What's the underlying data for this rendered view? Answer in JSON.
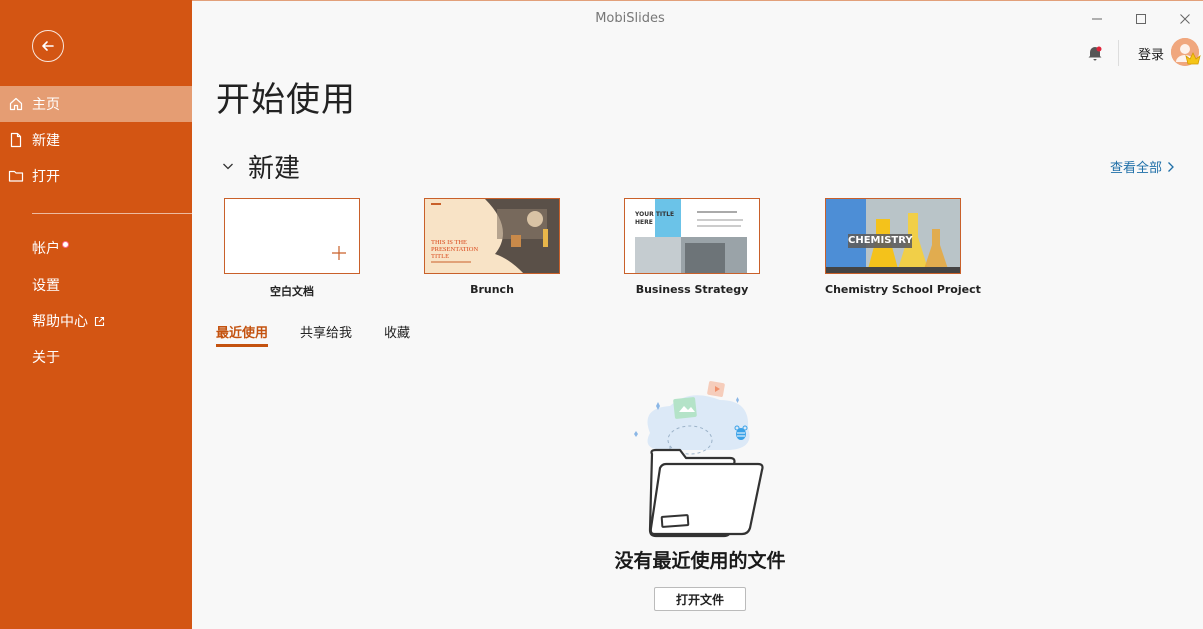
{
  "app": {
    "title": "MobiSlides"
  },
  "sidebar": {
    "nav": [
      {
        "label": "主页",
        "icon": "home-icon",
        "active": true
      },
      {
        "label": "新建",
        "icon": "new-file-icon"
      },
      {
        "label": "打开",
        "icon": "folder-icon"
      }
    ],
    "links": [
      {
        "label": "帐户"
      },
      {
        "label": "设置"
      },
      {
        "label": "帮助中心"
      },
      {
        "label": "关于"
      }
    ]
  },
  "account": {
    "login_label": "登录"
  },
  "main": {
    "page_title": "开始使用",
    "new_section": {
      "title": "新建",
      "see_all": "查看全部",
      "templates": [
        {
          "name": "空白文档"
        },
        {
          "name": "Brunch",
          "thumb_title": "THIS IS THE PRESENTATION TITLE"
        },
        {
          "name": "Business Strategy",
          "thumb_title": "YOUR TITLE HERE"
        },
        {
          "name": "Chemistry School Project",
          "thumb_title": "CHEMISTRY"
        }
      ]
    },
    "tabs": [
      {
        "label": "最近使用",
        "active": true
      },
      {
        "label": "共享给我"
      },
      {
        "label": "收藏"
      }
    ],
    "empty_state": {
      "message": "没有最近使用的文件",
      "open_button": "打开文件"
    }
  },
  "colors": {
    "accent": "#d35513",
    "link": "#1f6fa8"
  }
}
